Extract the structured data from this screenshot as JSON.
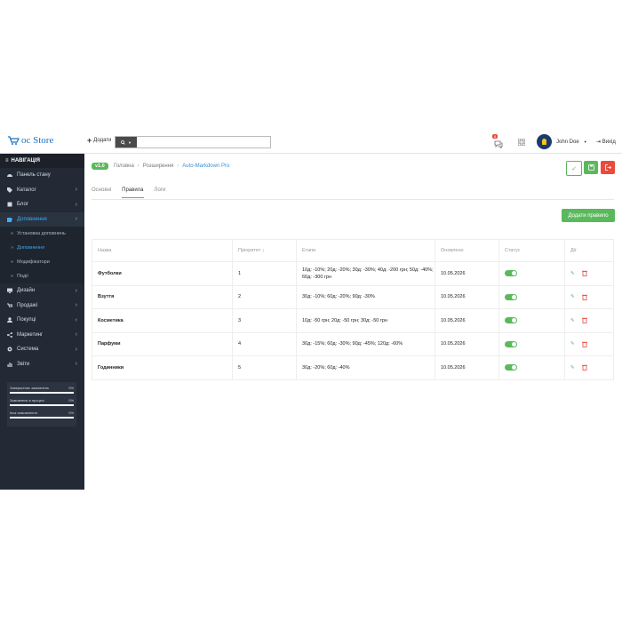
{
  "header": {
    "logo_text": "oc Store",
    "add_label": "Додати",
    "search_placeholder": "",
    "notification_count": "8",
    "user_name": "John Doe",
    "logout_label": "Вихід"
  },
  "sidebar": {
    "title": "НАВІГАЦІЯ",
    "items": [
      {
        "label": "Панель стану",
        "icon": "dashboard-icon",
        "chevron": false
      },
      {
        "label": "Каталог",
        "icon": "tag-icon",
        "chevron": true
      },
      {
        "label": "Блог",
        "icon": "book-icon",
        "chevron": true
      },
      {
        "label": "Доповнення",
        "icon": "puzzle-icon",
        "chevron": true,
        "active": true
      }
    ],
    "sub_items": [
      {
        "label": "Установка доповнень"
      },
      {
        "label": "Доповнення",
        "active": true
      },
      {
        "label": "Модифікатори"
      },
      {
        "label": "Події"
      }
    ],
    "items2": [
      {
        "label": "Дизайн",
        "icon": "monitor-icon"
      },
      {
        "label": "Продажі",
        "icon": "cart-icon"
      },
      {
        "label": "Покупці",
        "icon": "user-icon"
      },
      {
        "label": "Маркетинг",
        "icon": "share-icon"
      },
      {
        "label": "Система",
        "icon": "gear-icon"
      },
      {
        "label": "Звіти",
        "icon": "chart-icon"
      }
    ],
    "stats": [
      {
        "label": "Завершених замовлень",
        "value": "0%"
      },
      {
        "label": "Замовлень в процесі",
        "value": "0%"
      },
      {
        "label": "Інші замовлення",
        "value": "0%"
      }
    ]
  },
  "main": {
    "version": "v1.0",
    "breadcrumbs": [
      "Головна",
      "Розширення",
      "Auto-Markdown Pro"
    ],
    "tabs": [
      "Основні",
      "Правила",
      "Логи"
    ],
    "active_tab": 1,
    "add_rule_label": "Додати правило",
    "table": {
      "headers": [
        "Назва",
        "Пріоритет ↓",
        "Етапи",
        "Оновлено",
        "Статус",
        "Дії"
      ],
      "rows": [
        {
          "name": "Футболки",
          "priority": "1",
          "stages": "10д: -10%; 20д: -20%; 30д: -30%; 40д: -200 грн; 50д: -40%; 60д: -300 грн",
          "updated": "10.05.2026",
          "status": true
        },
        {
          "name": "Взуття",
          "priority": "2",
          "stages": "30д: -10%; 60д: -20%; 90д: -30%",
          "updated": "10.05.2026",
          "status": true
        },
        {
          "name": "Косметика",
          "priority": "3",
          "stages": "10д: -50 грн; 20д: -50 грн; 30д: -50 грн",
          "updated": "10.05.2026",
          "status": true
        },
        {
          "name": "Парфуми",
          "priority": "4",
          "stages": "30д: -15%; 60д: -30%; 90д: -45%; 120д: -60%",
          "updated": "10.05.2026",
          "status": true
        },
        {
          "name": "Годинники",
          "priority": "5",
          "stages": "30д: -20%; 60д: -40%",
          "updated": "10.05.2026",
          "status": true
        }
      ]
    }
  },
  "colors": {
    "accent": "#5cb85c",
    "danger": "#e74c3c",
    "link": "#3a8fd6",
    "sidebar": "#232a35"
  }
}
